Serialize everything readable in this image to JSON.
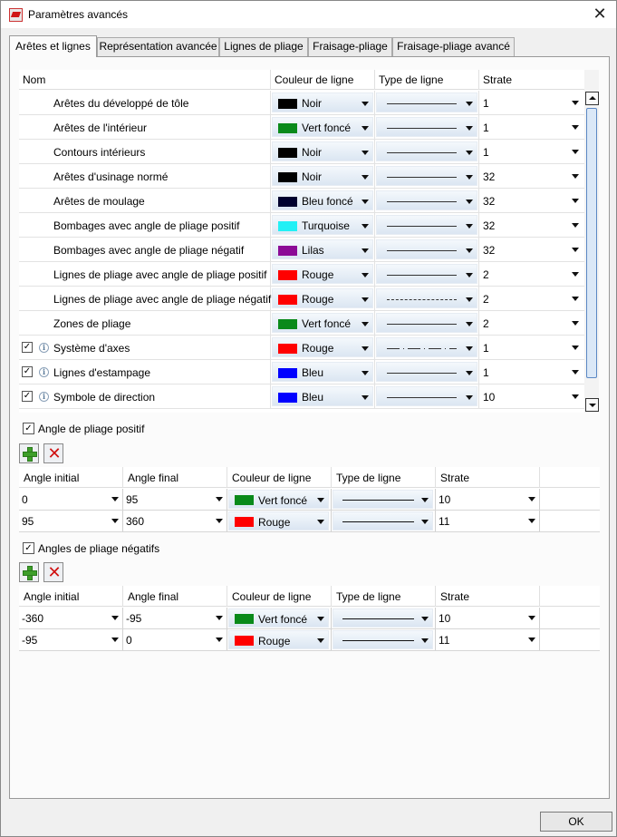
{
  "window": {
    "title": "Paramètres avancés",
    "close_glyph": "✕"
  },
  "tabs": [
    {
      "label": "Arêtes et lignes"
    },
    {
      "label": "Représentation avancée"
    },
    {
      "label": "Lignes de pliage"
    },
    {
      "label": "Fraisage-pliage"
    },
    {
      "label": "Fraisage-pliage avancé"
    }
  ],
  "main_grid": {
    "headers": {
      "name": "Nom",
      "color": "Couleur de ligne",
      "linetype": "Type de ligne",
      "strata": "Strate"
    },
    "rows": [
      {
        "checkbox": false,
        "info": false,
        "name": "Arêtes du développé de tôle",
        "color_name": "Noir",
        "color_hex": "#000000",
        "line": "solid",
        "strata": "1"
      },
      {
        "checkbox": false,
        "info": false,
        "name": "Arêtes de l'intérieur",
        "color_name": "Vert foncé",
        "color_hex": "#0a8a1a",
        "line": "solid",
        "strata": "1"
      },
      {
        "checkbox": false,
        "info": false,
        "name": "Contours intérieurs",
        "color_name": "Noir",
        "color_hex": "#000000",
        "line": "solid",
        "strata": "1"
      },
      {
        "checkbox": false,
        "info": false,
        "name": "Arêtes d'usinage normé",
        "color_name": "Noir",
        "color_hex": "#000000",
        "line": "solid",
        "strata": "32"
      },
      {
        "checkbox": false,
        "info": false,
        "name": "Arêtes de moulage",
        "color_name": "Bleu foncé",
        "color_hex": "#00002e",
        "line": "solid",
        "strata": "32"
      },
      {
        "checkbox": false,
        "info": false,
        "name": "Bombages avec angle de pliage positif",
        "color_name": "Turquoise",
        "color_hex": "#22f0f5",
        "line": "solid",
        "strata": "32"
      },
      {
        "checkbox": false,
        "info": false,
        "name": "Bombages avec angle de pliage négatif",
        "color_name": "Lilas",
        "color_hex": "#8c0b96",
        "line": "solid",
        "strata": "32"
      },
      {
        "checkbox": false,
        "info": false,
        "name": "Lignes de pliage avec angle de pliage positif",
        "color_name": "Rouge",
        "color_hex": "#ff0000",
        "line": "solid",
        "strata": "2"
      },
      {
        "checkbox": false,
        "info": false,
        "name": "Lignes de pliage avec angle de pliage négatif",
        "color_name": "Rouge",
        "color_hex": "#ff0000",
        "line": "dashed",
        "strata": "2"
      },
      {
        "checkbox": false,
        "info": false,
        "name": "Zones de pliage",
        "color_name": "Vert foncé",
        "color_hex": "#0a8a1a",
        "line": "solid",
        "strata": "2"
      },
      {
        "checkbox": true,
        "info": true,
        "name": "Système d'axes",
        "color_name": "Rouge",
        "color_hex": "#ff0000",
        "line": "dashdot",
        "strata": "1"
      },
      {
        "checkbox": true,
        "info": true,
        "name": "Lignes d'estampage",
        "color_name": "Bleu",
        "color_hex": "#0000ff",
        "line": "solid",
        "strata": "1"
      },
      {
        "checkbox": true,
        "info": true,
        "name": "Symbole de direction",
        "color_name": "Bleu",
        "color_hex": "#0000ff",
        "line": "solid",
        "strata": "10"
      }
    ]
  },
  "positive_section": {
    "checked": true,
    "label": "Angle de pliage positif",
    "headers": {
      "start": "Angle initial",
      "end": "Angle final",
      "color": "Couleur de ligne",
      "linetype": "Type de ligne",
      "strata": "Strate"
    },
    "rows": [
      {
        "start": "0",
        "end": "95",
        "color_name": "Vert foncé",
        "color_hex": "#0a8a1a",
        "strata": "10"
      },
      {
        "start": "95",
        "end": "360",
        "color_name": "Rouge",
        "color_hex": "#ff0000",
        "strata": "11"
      }
    ]
  },
  "negative_section": {
    "checked": true,
    "label": "Angles de pliage négatifs",
    "headers": {
      "start": "Angle initial",
      "end": "Angle final",
      "color": "Couleur de ligne",
      "linetype": "Type de ligne",
      "strata": "Strate"
    },
    "rows": [
      {
        "start": "-360",
        "end": "-95",
        "color_name": "Vert foncé",
        "color_hex": "#0a8a1a",
        "strata": "10"
      },
      {
        "start": "-95",
        "end": "0",
        "color_name": "Rouge",
        "color_hex": "#ff0000",
        "strata": "11"
      }
    ]
  },
  "footer": {
    "ok_label": "OK"
  }
}
